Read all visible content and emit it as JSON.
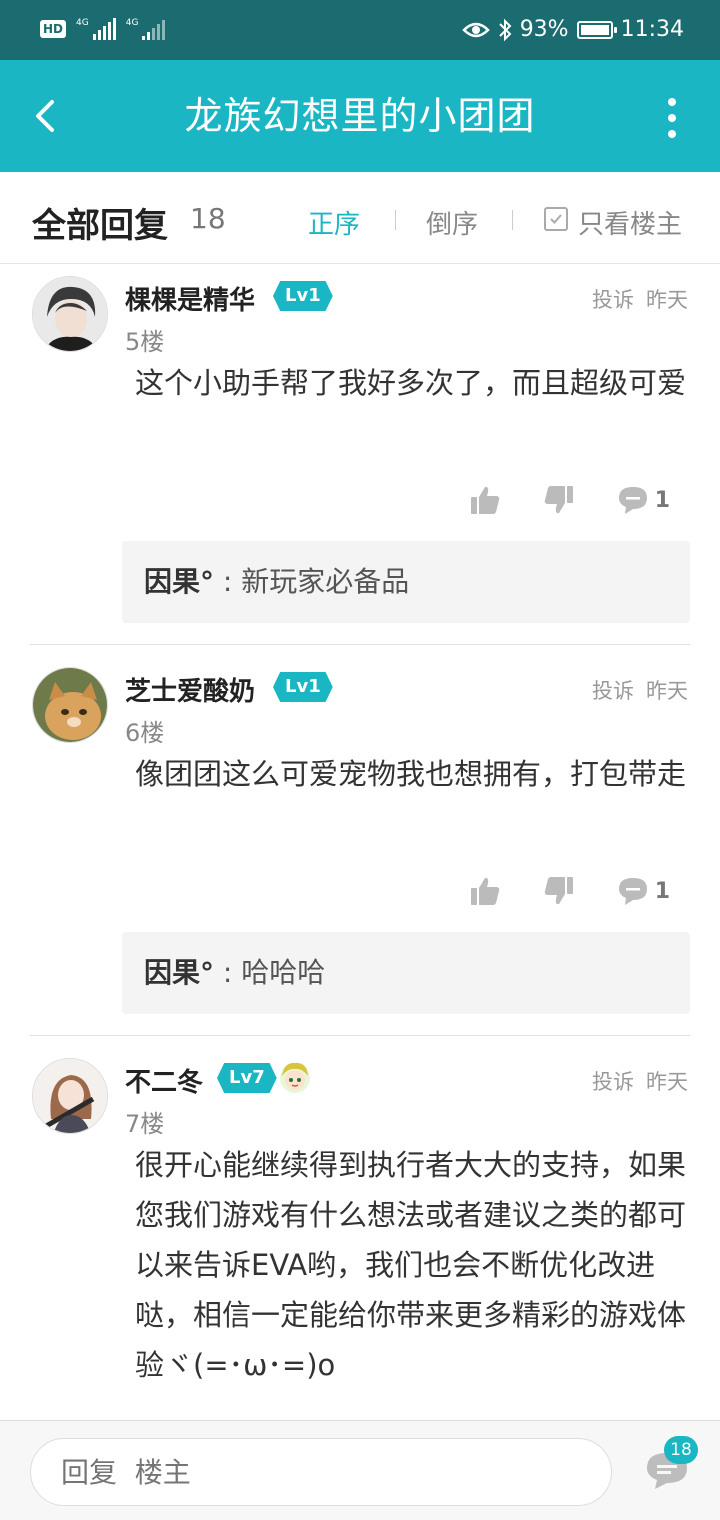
{
  "status_bar": {
    "network_1": "4G",
    "network_2": "4G",
    "battery": "93%",
    "time": "11:34"
  },
  "app_bar": {
    "title": "龙族幻想里的小团团"
  },
  "reply_header": {
    "title": "全部回复",
    "count": "18",
    "sort_asc": "正序",
    "sort_desc": "倒序",
    "only_op": "只看楼主",
    "only_op_checked": true,
    "accent_color": "#1ab6c3"
  },
  "posts": [
    {
      "username": "棵棵是精华",
      "level": "Lv1",
      "report": "投诉",
      "time": "昨天",
      "floor": "5楼",
      "content": "这个小助手帮了我好多次了，而且超级可爱",
      "comment_count": "1",
      "subreply": {
        "author": "因果°",
        "sep": " : ",
        "text": "新玩家必备品"
      }
    },
    {
      "username": "芝士爱酸奶",
      "level": "Lv1",
      "report": "投诉",
      "time": "昨天",
      "floor": "6楼",
      "content": "像团团这么可爱宠物我也想拥有，打包带走",
      "comment_count": "1",
      "subreply": {
        "author": "因果°",
        "sep": " : ",
        "text": "哈哈哈"
      }
    },
    {
      "username": "不二冬",
      "level": "Lv7",
      "report": "投诉",
      "time": "昨天",
      "floor": "7楼",
      "content": "很开心能继续得到执行者大大的支持，如果您我们游戏有什么想法或者建议之类的都可以来告诉EVA哟，我们也会不断优化改进哒，相信一定能给你带来更多精彩的游戏体验ヾ(=･ω･=)o"
    }
  ],
  "bottom_bar": {
    "placeholder": "回复  楼主",
    "comment_badge": "18"
  }
}
